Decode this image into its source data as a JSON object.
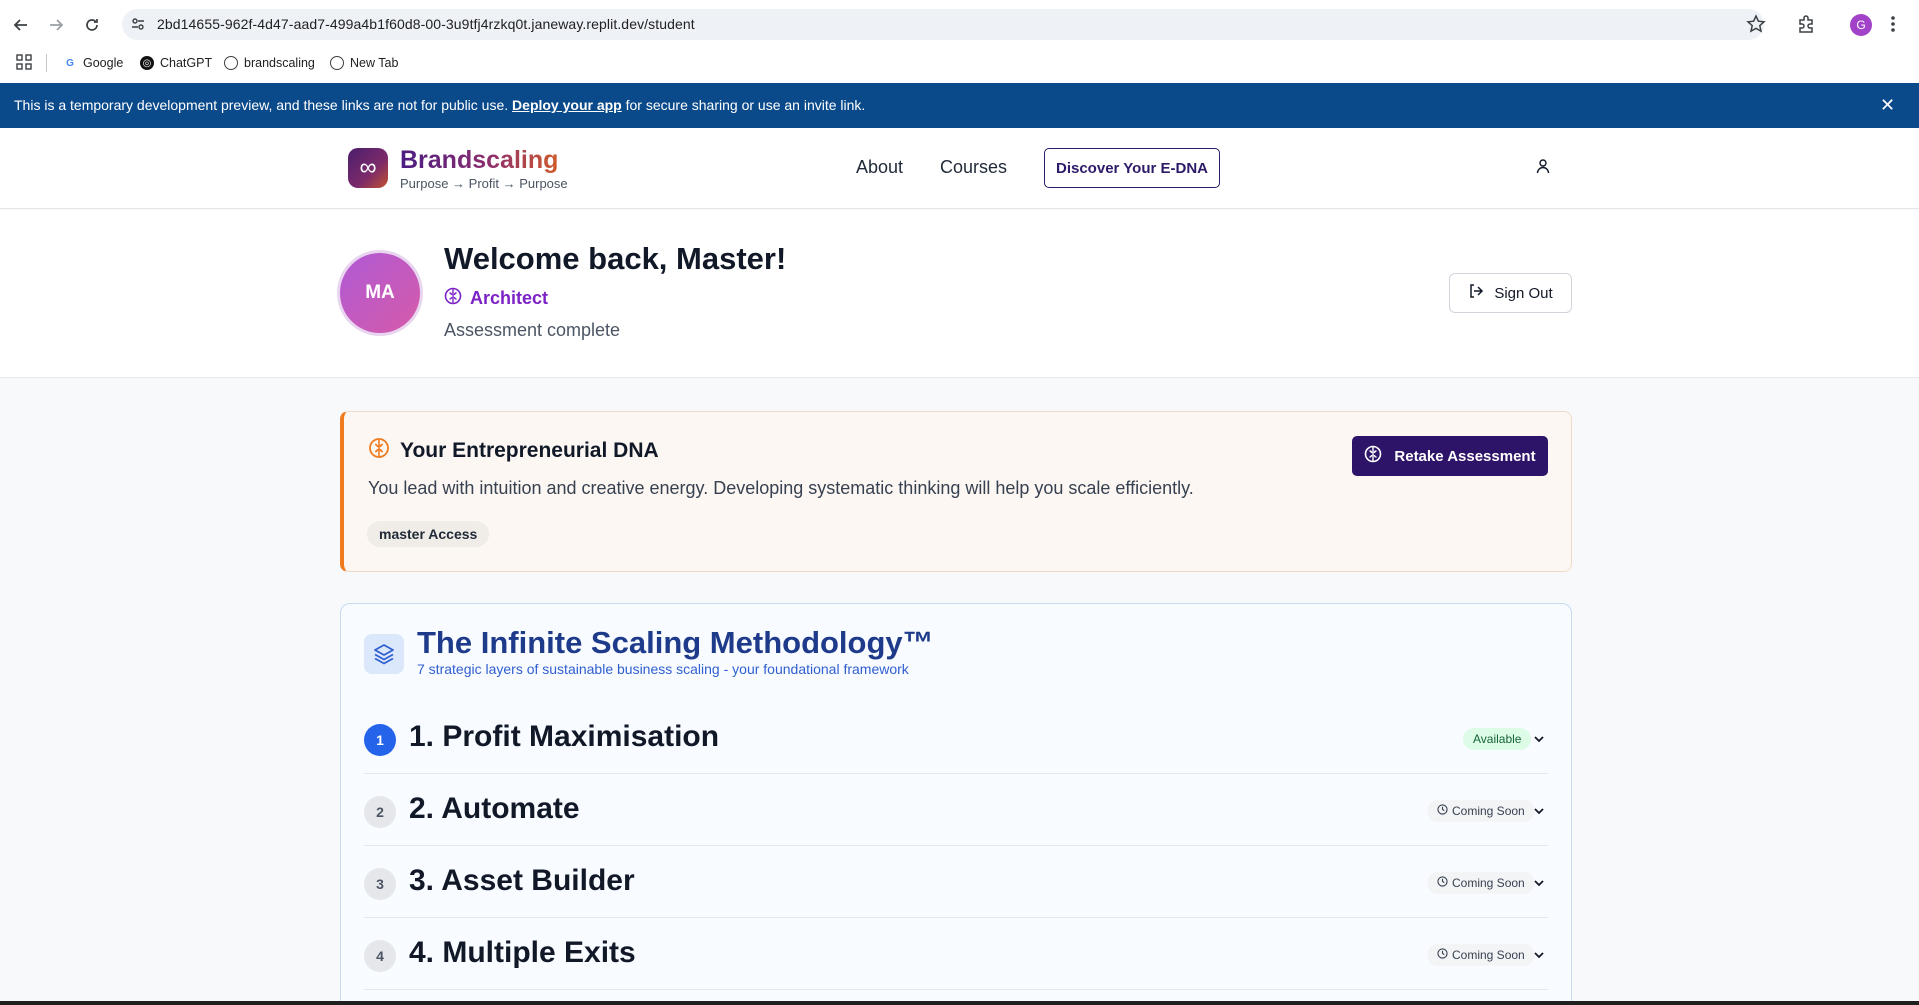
{
  "browser": {
    "url": "2bd14655-962f-4d47-aad7-499a4b1f60d8-00-3u9tfj4rzkq0t.janeway.replit.dev/student",
    "profile_initial": "G",
    "bookmarks": [
      {
        "label": "Google"
      },
      {
        "label": "ChatGPT"
      },
      {
        "label": "brandscaling"
      },
      {
        "label": "New Tab"
      }
    ]
  },
  "banner": {
    "text_before": "This is a temporary development preview, and these links are not for public use. ",
    "link": "Deploy your app",
    "text_after": " for secure sharing or use an invite link.",
    "close": "✕"
  },
  "header": {
    "logo_symbol": "∞",
    "brand": "Brandscaling",
    "tagline": "Purpose → Profit → Purpose",
    "nav": [
      "About",
      "Courses"
    ],
    "cta": "Discover Your E-DNA"
  },
  "welcome": {
    "initials": "MA",
    "title": "Welcome back, Master!",
    "type": "Architect",
    "status": "Assessment complete",
    "signout": "Sign Out"
  },
  "dna": {
    "title": "Your Entrepreneurial DNA",
    "description": "You lead with intuition and creative energy. Developing systematic thinking will help you scale efficiently.",
    "access": "master Access",
    "retake": "Retake Assessment",
    "accent": "#f07b1f"
  },
  "methodology": {
    "title": "The Infinite Scaling Methodology™",
    "subtitle": "7 strategic layers of sustainable business scaling - your foundational framework",
    "layers": [
      {
        "num": "1",
        "title": "1. Profit Maximisation",
        "status": "Available"
      },
      {
        "num": "2",
        "title": "2. Automate",
        "status": "Coming Soon"
      },
      {
        "num": "3",
        "title": "3. Asset Builder",
        "status": "Coming Soon"
      },
      {
        "num": "4",
        "title": "4. Multiple Exits",
        "status": "Coming Soon"
      }
    ]
  }
}
